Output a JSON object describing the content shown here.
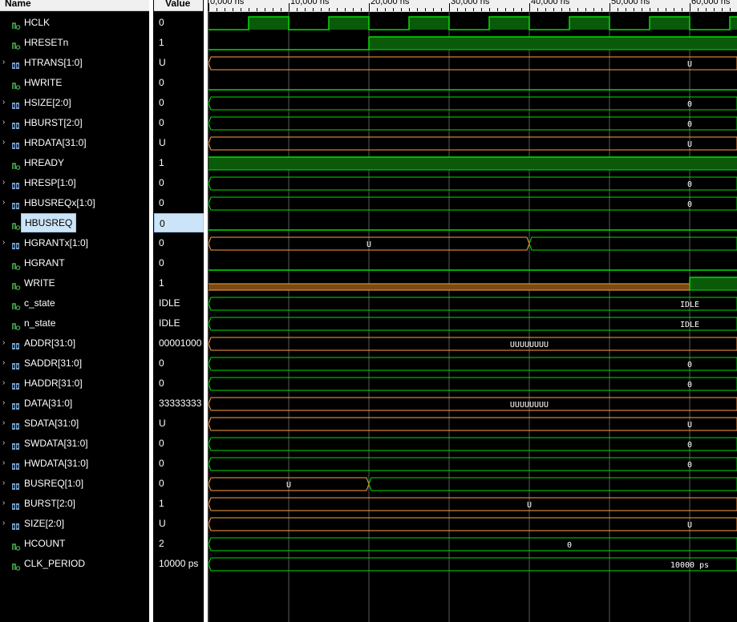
{
  "header": {
    "name_col": "Name",
    "value_col": "Value"
  },
  "ruler": {
    "ticks": [
      "0,000 ns",
      "10,000 ns",
      "20,000 ns",
      "30,000 ns",
      "40,000 ns",
      "50,000 ns",
      "60,000 ns"
    ],
    "range_ns": [
      0,
      66000
    ]
  },
  "signals": [
    {
      "name": "HCLK",
      "value": "0",
      "kind": "bit",
      "expandable": false,
      "wave": {
        "type": "clock",
        "period": 10000,
        "high_start": 5000
      }
    },
    {
      "name": "HRESETn",
      "value": "1",
      "kind": "bit",
      "expandable": false,
      "wave": {
        "type": "bit",
        "edges": [
          [
            0,
            0
          ],
          [
            20000,
            1
          ]
        ]
      }
    },
    {
      "name": "HTRANS[1:0]",
      "value": "U",
      "kind": "bus",
      "expandable": true,
      "wave": {
        "type": "bus",
        "segments": [
          {
            "from": 0,
            "label": "U",
            "color": "orange"
          }
        ]
      }
    },
    {
      "name": "HWRITE",
      "value": "0",
      "kind": "bit",
      "expandable": false,
      "wave": {
        "type": "bit",
        "edges": [
          [
            0,
            0
          ]
        ]
      }
    },
    {
      "name": "HSIZE[2:0]",
      "value": "0",
      "kind": "bus",
      "expandable": true,
      "wave": {
        "type": "bus",
        "segments": [
          {
            "from": 0,
            "label": "0",
            "color": "green"
          }
        ]
      }
    },
    {
      "name": "HBURST[2:0]",
      "value": "0",
      "kind": "bus",
      "expandable": true,
      "wave": {
        "type": "bus",
        "segments": [
          {
            "from": 0,
            "label": "0",
            "color": "green"
          }
        ]
      }
    },
    {
      "name": "HRDATA[31:0]",
      "value": "U",
      "kind": "bus",
      "expandable": true,
      "wave": {
        "type": "bus",
        "segments": [
          {
            "from": 0,
            "label": "U",
            "color": "orange"
          }
        ]
      }
    },
    {
      "name": "HREADY",
      "value": "1",
      "kind": "bit",
      "expandable": false,
      "wave": {
        "type": "bit",
        "edges": [
          [
            0,
            1
          ]
        ]
      }
    },
    {
      "name": "HRESP[1:0]",
      "value": "0",
      "kind": "bus",
      "expandable": true,
      "wave": {
        "type": "bus",
        "segments": [
          {
            "from": 0,
            "label": "0",
            "color": "green"
          }
        ]
      }
    },
    {
      "name": "HBUSREQx[1:0]",
      "value": "0",
      "kind": "bus",
      "expandable": true,
      "wave": {
        "type": "bus",
        "segments": [
          {
            "from": 0,
            "label": "0",
            "color": "green"
          }
        ]
      }
    },
    {
      "name": "HBUSREQ",
      "value": "0",
      "kind": "bit",
      "expandable": false,
      "selected": true,
      "wave": {
        "type": "bit",
        "edges": [
          [
            0,
            0
          ]
        ]
      }
    },
    {
      "name": "HGRANTx[1:0]",
      "value": "0",
      "kind": "bus",
      "expandable": true,
      "wave": {
        "type": "bus",
        "segments": [
          {
            "from": 0,
            "label": "U",
            "color": "orange"
          },
          {
            "from": 40000,
            "label": "",
            "color": "green"
          }
        ]
      }
    },
    {
      "name": "HGRANT",
      "value": "0",
      "kind": "bit",
      "expandable": false,
      "wave": {
        "type": "bit",
        "edges": [
          [
            0,
            0
          ]
        ]
      }
    },
    {
      "name": "WRITE",
      "value": "1",
      "kind": "bit",
      "expandable": false,
      "wave": {
        "type": "bit",
        "edges": [
          [
            0,
            "X"
          ],
          [
            60000,
            1
          ]
        ]
      }
    },
    {
      "name": "c_state",
      "value": "IDLE",
      "kind": "enum",
      "expandable": false,
      "wave": {
        "type": "bus",
        "segments": [
          {
            "from": 0,
            "label": "IDLE",
            "color": "green"
          }
        ]
      }
    },
    {
      "name": "n_state",
      "value": "IDLE",
      "kind": "enum",
      "expandable": false,
      "wave": {
        "type": "bus",
        "segments": [
          {
            "from": 0,
            "label": "IDLE",
            "color": "green"
          }
        ]
      }
    },
    {
      "name": "ADDR[31:0]",
      "value": "00001000",
      "kind": "bus",
      "expandable": true,
      "wave": {
        "type": "bus",
        "segments": [
          {
            "from": 0,
            "label": "UUUUUUUU",
            "color": "orange"
          }
        ]
      }
    },
    {
      "name": "SADDR[31:0]",
      "value": "0",
      "kind": "bus",
      "expandable": true,
      "wave": {
        "type": "bus",
        "segments": [
          {
            "from": 0,
            "label": "0",
            "color": "green"
          }
        ]
      }
    },
    {
      "name": "HADDR[31:0]",
      "value": "0",
      "kind": "bus",
      "expandable": true,
      "wave": {
        "type": "bus",
        "segments": [
          {
            "from": 0,
            "label": "0",
            "color": "green"
          }
        ]
      }
    },
    {
      "name": "DATA[31:0]",
      "value": "33333333",
      "kind": "bus",
      "expandable": true,
      "wave": {
        "type": "bus",
        "segments": [
          {
            "from": 0,
            "label": "UUUUUUUU",
            "color": "orange"
          }
        ]
      }
    },
    {
      "name": "SDATA[31:0]",
      "value": "U",
      "kind": "bus",
      "expandable": true,
      "wave": {
        "type": "bus",
        "segments": [
          {
            "from": 0,
            "label": "U",
            "color": "orange"
          }
        ]
      }
    },
    {
      "name": "SWDATA[31:0]",
      "value": "0",
      "kind": "bus",
      "expandable": true,
      "wave": {
        "type": "bus",
        "segments": [
          {
            "from": 0,
            "label": "0",
            "color": "green"
          }
        ]
      }
    },
    {
      "name": "HWDATA[31:0]",
      "value": "0",
      "kind": "bus",
      "expandable": true,
      "wave": {
        "type": "bus",
        "segments": [
          {
            "from": 0,
            "label": "0",
            "color": "green"
          }
        ]
      }
    },
    {
      "name": "BUSREQ[1:0]",
      "value": "0",
      "kind": "bus",
      "expandable": true,
      "wave": {
        "type": "bus",
        "segments": [
          {
            "from": 0,
            "label": "U",
            "color": "orange"
          },
          {
            "from": 20000,
            "label": "",
            "color": "green"
          }
        ]
      }
    },
    {
      "name": "BURST[2:0]",
      "value": "1",
      "kind": "bus",
      "expandable": true,
      "wave": {
        "type": "bus",
        "segments": [
          {
            "from": 0,
            "label": "U",
            "color": "orange"
          }
        ]
      }
    },
    {
      "name": "SIZE[2:0]",
      "value": "U",
      "kind": "bus",
      "expandable": true,
      "wave": {
        "type": "bus",
        "segments": [
          {
            "from": 0,
            "label": "U",
            "color": "orange"
          }
        ]
      }
    },
    {
      "name": "HCOUNT",
      "value": "2",
      "kind": "int",
      "expandable": false,
      "wave": {
        "type": "bus",
        "segments": [
          {
            "from": 0,
            "label": "0",
            "color": "green"
          }
        ]
      }
    },
    {
      "name": "CLK_PERIOD",
      "value": "10000 ps",
      "kind": "int",
      "expandable": false,
      "wave": {
        "type": "bus",
        "segments": [
          {
            "from": 0,
            "label": "10000 ps",
            "color": "green"
          }
        ]
      }
    }
  ],
  "colors": {
    "background": "#000000",
    "wave_green": "#00e000",
    "wave_fill": "#0a5a0a",
    "bus_orange": "#ffa040",
    "x_fill": "#7a4a10",
    "grid": "#5a5a5a",
    "selection": "#cce4f7"
  }
}
